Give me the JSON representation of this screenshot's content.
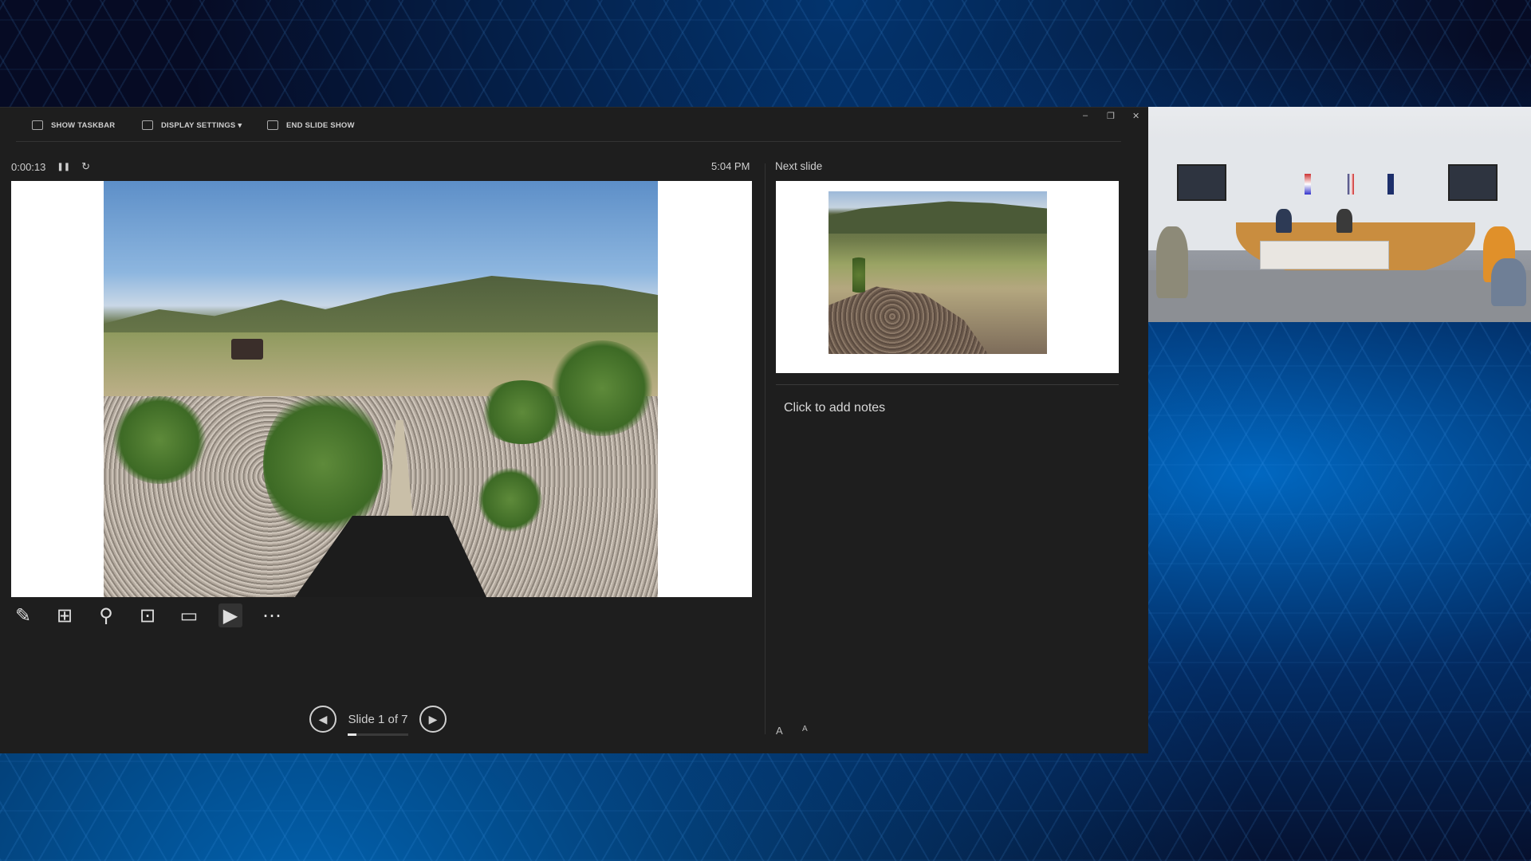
{
  "toolbar": {
    "show_taskbar": "SHOW TASKBAR",
    "display_settings": "DISPLAY SETTINGS ▾",
    "end_slide_show": "END SLIDE SHOW"
  },
  "window_controls": {
    "minimize": "–",
    "restore": "❐",
    "close": "✕"
  },
  "presenter": {
    "elapsed_time": "0:00:13",
    "pause_icon": "❚❚",
    "reset_icon": "↻",
    "clock": "5:04 PM",
    "next_slide_label": "Next slide",
    "notes_placeholder": "Click to add notes"
  },
  "tools": [
    {
      "name": "pen-tool-icon",
      "glyph": "✎"
    },
    {
      "name": "see-all-slides-icon",
      "glyph": "⊞"
    },
    {
      "name": "zoom-icon",
      "glyph": "⚲"
    },
    {
      "name": "pointer-options-icon",
      "glyph": "⊡"
    },
    {
      "name": "subtitles-icon",
      "glyph": "▭"
    },
    {
      "name": "camera-icon",
      "glyph": "▶"
    },
    {
      "name": "more-options-icon",
      "glyph": "⋯"
    }
  ],
  "navigation": {
    "prev": "◀",
    "next": "▶",
    "slide_counter": "Slide 1 of 7",
    "current_slide": 1,
    "total_slides": 7
  },
  "notes_font": {
    "increase": "A",
    "decrease": "A"
  },
  "colors": {
    "presenter_bg": "#1e1e1e",
    "background_blue": "#0a5cb8"
  }
}
